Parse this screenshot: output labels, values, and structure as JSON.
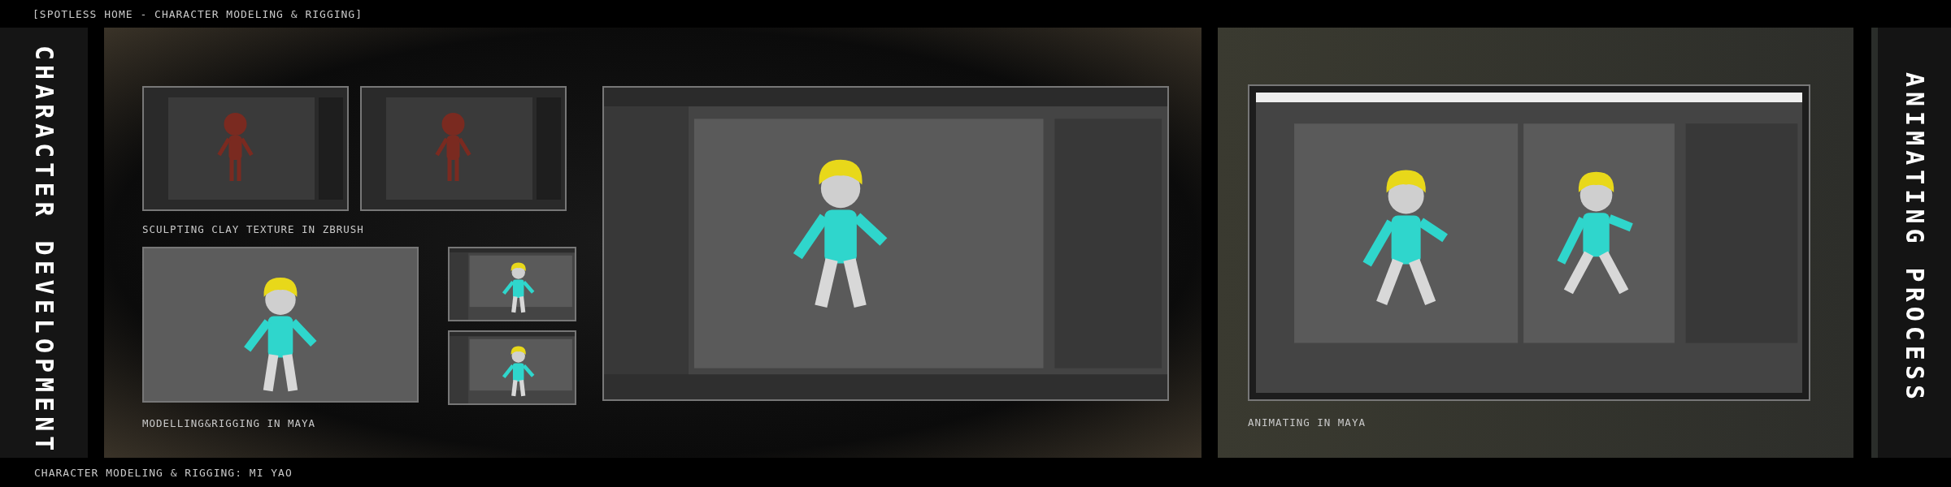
{
  "header": {
    "title": "[SPOTLESS HOME - CHARACTER MODELING & RIGGING]"
  },
  "left_banner": {
    "label": "CHARACTER DEVELOPMENT"
  },
  "gallery": {
    "top_shots": [
      {
        "kind": "zbrush"
      },
      {
        "kind": "zbrush"
      }
    ],
    "top_caption": "SCULPTING CLAY TEXTURE IN ZBRUSH",
    "bottom_shots": [
      {
        "kind": "maya_viewport"
      },
      {
        "kind": "maya_small"
      },
      {
        "kind": "maya_small"
      }
    ],
    "bottom_caption": "MODELLING&RIGGING IN MAYA",
    "main_shot": {
      "kind": "maya_full"
    }
  },
  "animation": {
    "shot": {
      "kind": "maya_anim"
    },
    "caption": "ANIMATING IN MAYA"
  },
  "right_banner": {
    "label": "ANIMATING PROCESS"
  },
  "footer": {
    "credit": "CHARACTER MODELING & RIGGING: MI YAO"
  }
}
